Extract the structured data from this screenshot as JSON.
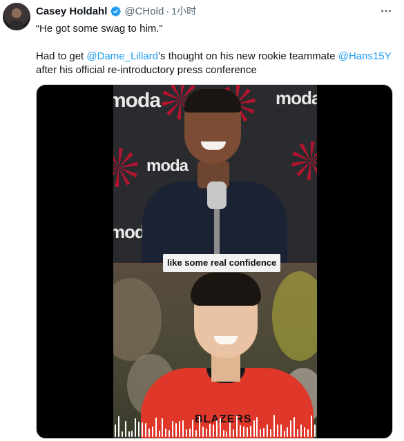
{
  "author": {
    "display_name": "Casey Holdahl",
    "handle": "@CHold",
    "separator": "·",
    "time": "1小时",
    "verified_icon": "verified-badge-icon",
    "more_icon": "more-options-icon"
  },
  "tweet": {
    "line1": "“He got some swag to him.”",
    "line2_pre": "Had to get ",
    "mention1": "@Dame_Lillard",
    "line2_mid": "’s thought on his new rookie teammate ",
    "mention2": "@Hans15Y",
    "line3": "after his official re-introductory press conference"
  },
  "media": {
    "backdrop_logo": "moda",
    "caption": "like some real confidence",
    "jersey_text": "BLAZERS"
  },
  "colors": {
    "accent": "#1d9bf0",
    "verified": "#1d9bf0",
    "muted": "#536471",
    "blazers_red": "#c8102e"
  }
}
